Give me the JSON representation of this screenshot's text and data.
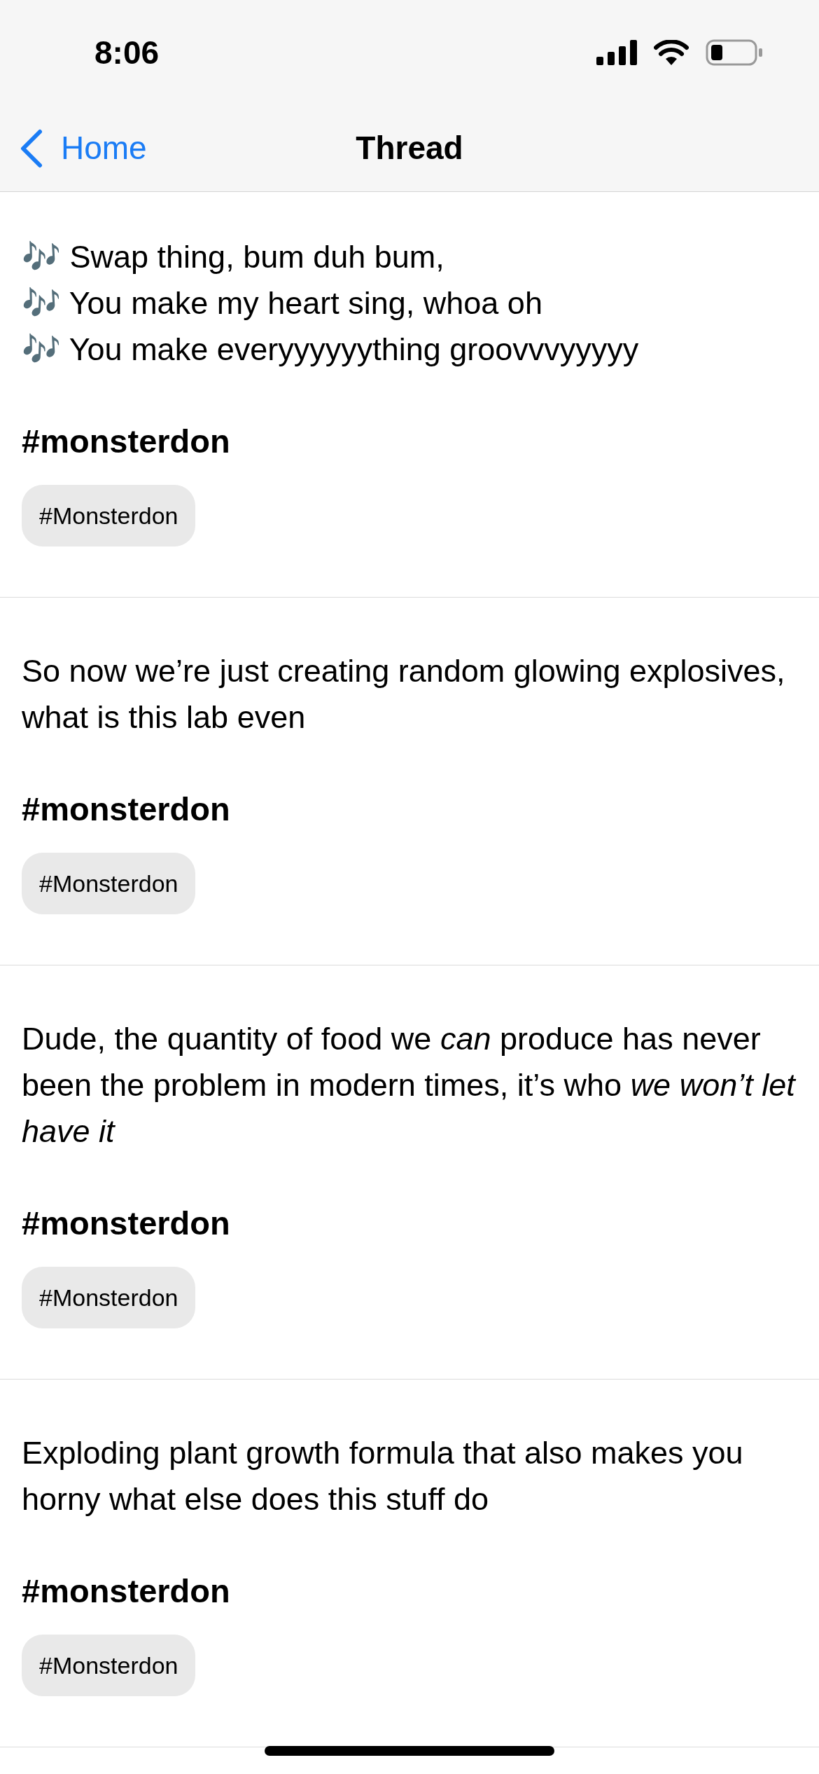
{
  "status_bar": {
    "time": "8:06"
  },
  "nav": {
    "back": "Home",
    "title": "Thread"
  },
  "posts": [
    {
      "paragraphs": [
        "🎶 Swap thing, bum duh bum,",
        "🎶 You make my heart sing, whoa oh",
        "🎶 You make everyyyyyything groovvvyyyyy"
      ],
      "heading": "#monsterdon",
      "tag": "#Monsterdon"
    },
    {
      "paragraphs": [
        "So now we’re just creating random glowing explosives, what is this lab even"
      ],
      "heading": "#monsterdon",
      "tag": "#Monsterdon"
    },
    {
      "paragraphs": [
        "Dude, the quantity of food we *can* produce has never been the problem in modern times, it’s who *we won’t let have it*"
      ],
      "heading": "#monsterdon",
      "tag": "#Monsterdon"
    },
    {
      "paragraphs": [
        "Exploding plant growth formula that also makes you horny what else does this stuff do"
      ],
      "heading": "#monsterdon",
      "tag": "#Monsterdon"
    }
  ]
}
